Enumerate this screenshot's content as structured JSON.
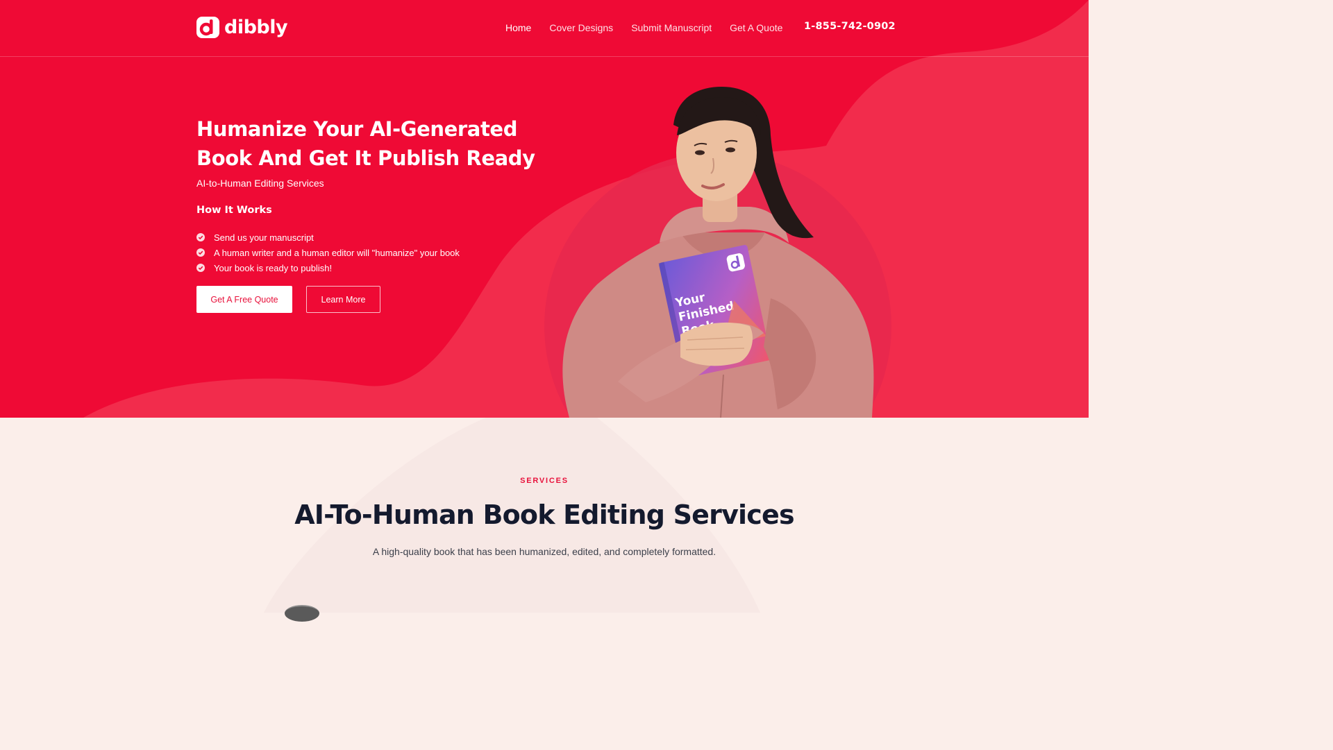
{
  "brand": {
    "name": "dibbly",
    "logo_letter": "d"
  },
  "nav": {
    "links": [
      {
        "label": "Home",
        "active": true
      },
      {
        "label": "Cover Designs",
        "active": false
      },
      {
        "label": "Submit Manuscript",
        "active": false
      },
      {
        "label": "Get A Quote",
        "active": false
      }
    ],
    "phone": "1-855-742-0902"
  },
  "hero": {
    "headline": "Humanize Your AI-Generated Book And Get It Publish Ready",
    "subtitle": "AI-to-Human Editing Services",
    "how_title": "How It Works",
    "steps": [
      "Send us your manuscript",
      "A human writer and a human editor will \"humanize\" your book",
      "Your book is ready to publish!"
    ],
    "primary_button": "Get A Free Quote",
    "secondary_button": "Learn More",
    "book": {
      "title_lines": [
        "Your",
        "Finished",
        "Book"
      ],
      "logo_letter": "d"
    }
  },
  "services": {
    "eyebrow": "SERVICES",
    "title": "AI-To-Human Book Editing Services",
    "description": "A high-quality book that has been humanized, edited, and completely formatted."
  },
  "colors": {
    "brand_red": "#ef0a35",
    "accent_red": "#e8113b",
    "cream": "#fbeeea",
    "dark_text": "#141a2e"
  }
}
